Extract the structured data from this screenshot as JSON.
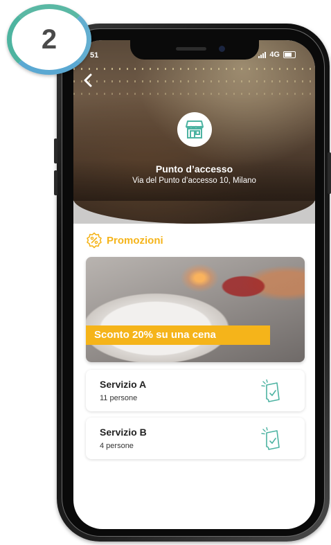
{
  "step": {
    "number": "2"
  },
  "status_bar": {
    "time": "51",
    "network": "4G"
  },
  "header": {
    "icon": "storefront-icon",
    "back_icon": "chevron-left-icon",
    "venue_name": "Punto d’accesso",
    "venue_address": "Via del Punto d’accesso 10, Milano"
  },
  "promotions": {
    "icon": "percent-badge-icon",
    "title": "Promozioni",
    "banner_text": "Sconto 20% su una cena"
  },
  "services": [
    {
      "name": "Servizio A",
      "count": "11 persone",
      "icon": "ticket-icon"
    },
    {
      "name": "Servizio B",
      "count": "4 persone",
      "icon": "ticket-icon"
    }
  ],
  "colors": {
    "accent": "#f5b41a",
    "teal": "#4eb4a0",
    "icon_teal": "#4db3a2"
  }
}
